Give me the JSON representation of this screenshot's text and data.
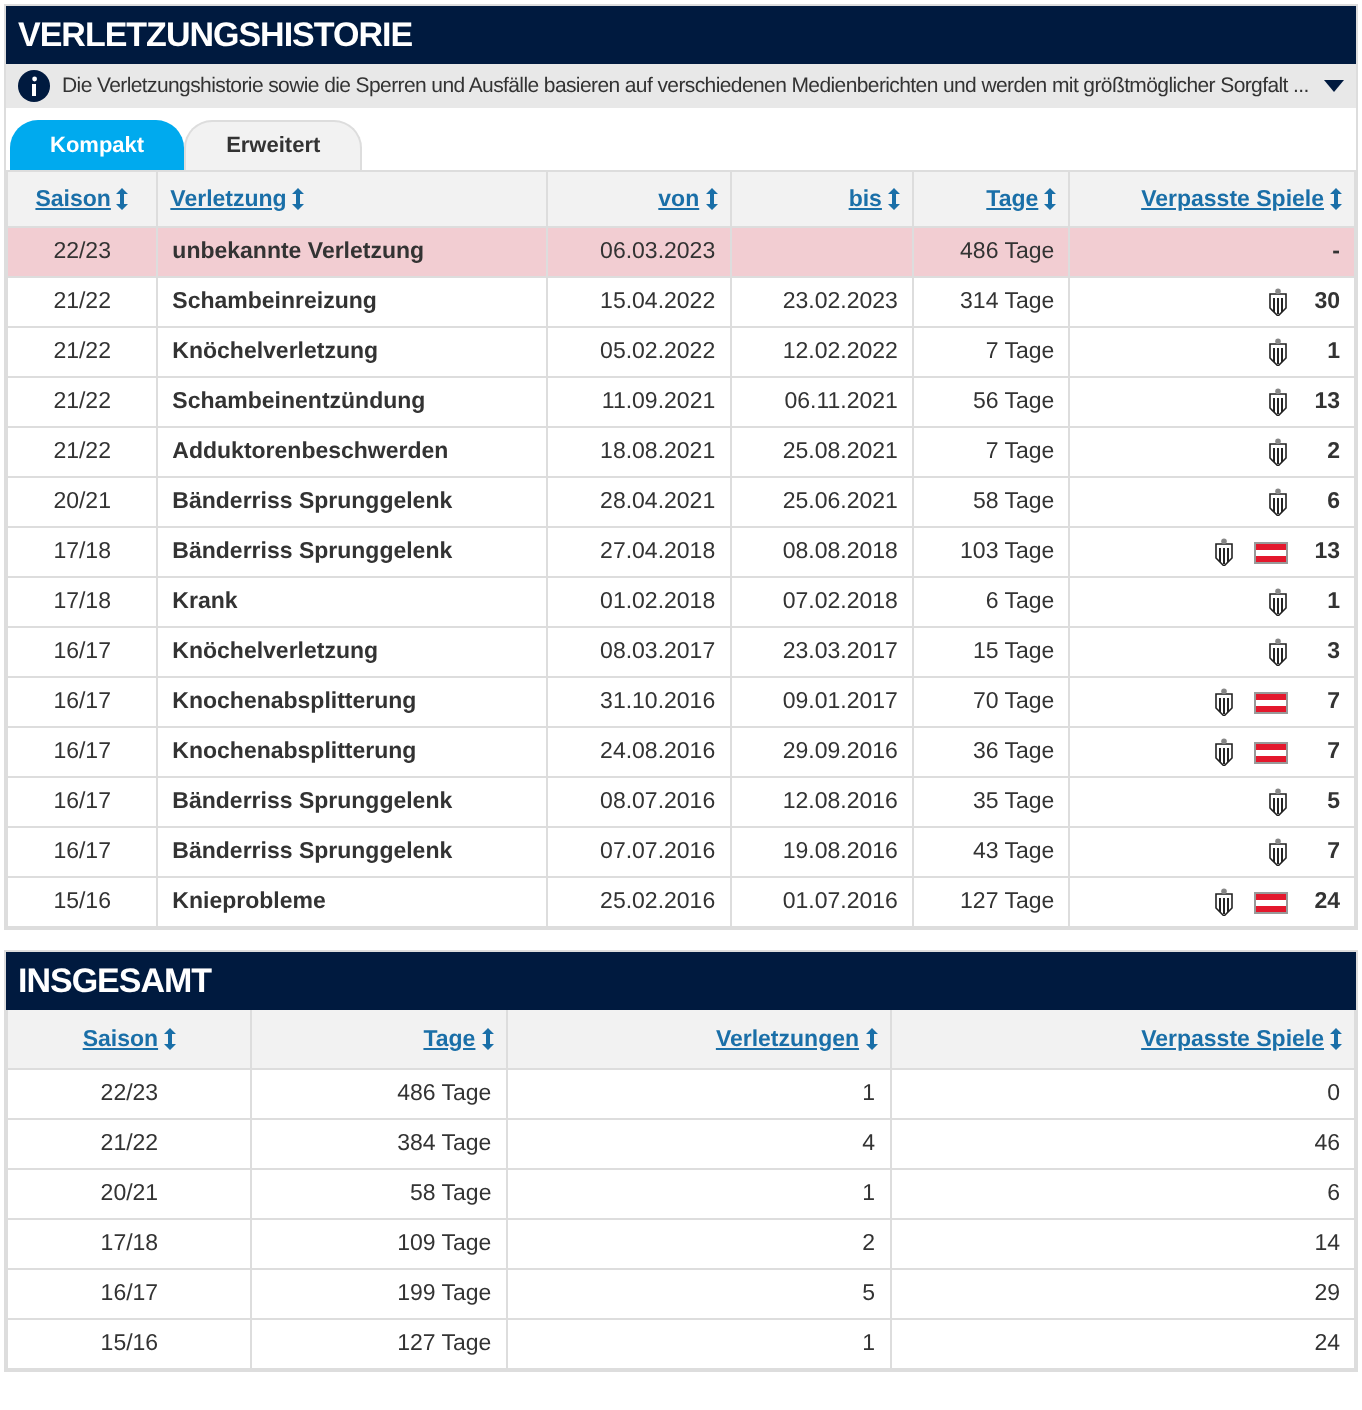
{
  "history": {
    "title": "VERLETZUNGSHISTORIE",
    "info": "Die Verletzungshistorie sowie die Sperren und Ausfälle basieren auf verschiedenen Medienberichten und werden mit größtmöglicher Sorgfalt ...",
    "tabs": [
      {
        "label": "Kompakt",
        "selected": true
      },
      {
        "label": "Erweitert",
        "selected": false
      }
    ],
    "columns": [
      "Saison",
      "Verletzung",
      "von",
      "bis",
      "Tage",
      "Verpasste Spiele"
    ],
    "rows": [
      {
        "season": "22/23",
        "injury": "unbekannte Verletzung",
        "from": "06.03.2023",
        "until": "",
        "days": "486 Tage",
        "icons": [],
        "games": "-",
        "current": true
      },
      {
        "season": "21/22",
        "injury": "Schambeinreizung",
        "from": "15.04.2022",
        "until": "23.02.2023",
        "days": "314 Tage",
        "icons": [
          {
            "kind": "club"
          }
        ],
        "games": "30",
        "current": false
      },
      {
        "season": "21/22",
        "injury": "Knöchelverletzung",
        "from": "05.02.2022",
        "until": "12.02.2022",
        "days": "7 Tage",
        "icons": [
          {
            "kind": "club"
          }
        ],
        "games": "1",
        "current": false
      },
      {
        "season": "21/22",
        "injury": "Schambeinentzündung",
        "from": "11.09.2021",
        "until": "06.11.2021",
        "days": "56 Tage",
        "icons": [
          {
            "kind": "club"
          }
        ],
        "games": "13",
        "current": false
      },
      {
        "season": "21/22",
        "injury": "Adduktorenbeschwerden",
        "from": "18.08.2021",
        "until": "25.08.2021",
        "days": "7 Tage",
        "icons": [
          {
            "kind": "club"
          }
        ],
        "games": "2",
        "current": false
      },
      {
        "season": "20/21",
        "injury": "Bänderriss Sprunggelenk",
        "from": "28.04.2021",
        "until": "25.06.2021",
        "days": "58 Tage",
        "icons": [
          {
            "kind": "club"
          }
        ],
        "games": "6",
        "current": false
      },
      {
        "season": "17/18",
        "injury": "Bänderriss Sprunggelenk",
        "from": "27.04.2018",
        "until": "08.08.2018",
        "days": "103 Tage",
        "icons": [
          {
            "kind": "club"
          },
          {
            "kind": "flag"
          }
        ],
        "games": "13",
        "current": false
      },
      {
        "season": "17/18",
        "injury": "Krank",
        "from": "01.02.2018",
        "until": "07.02.2018",
        "days": "6 Tage",
        "icons": [
          {
            "kind": "club"
          }
        ],
        "games": "1",
        "current": false
      },
      {
        "season": "16/17",
        "injury": "Knöchelverletzung",
        "from": "08.03.2017",
        "until": "23.03.2017",
        "days": "15 Tage",
        "icons": [
          {
            "kind": "club"
          }
        ],
        "games": "3",
        "current": false
      },
      {
        "season": "16/17",
        "injury": "Knochenabsplitterung",
        "from": "31.10.2016",
        "until": "09.01.2017",
        "days": "70 Tage",
        "icons": [
          {
            "kind": "club"
          },
          {
            "kind": "flag"
          }
        ],
        "games": "7",
        "current": false
      },
      {
        "season": "16/17",
        "injury": "Knochenabsplitterung",
        "from": "24.08.2016",
        "until": "29.09.2016",
        "days": "36 Tage",
        "icons": [
          {
            "kind": "club"
          },
          {
            "kind": "flag"
          }
        ],
        "games": "7",
        "current": false
      },
      {
        "season": "16/17",
        "injury": "Bänderriss Sprunggelenk",
        "from": "08.07.2016",
        "until": "12.08.2016",
        "days": "35 Tage",
        "icons": [
          {
            "kind": "club"
          }
        ],
        "games": "5",
        "current": false
      },
      {
        "season": "16/17",
        "injury": "Bänderriss Sprunggelenk",
        "from": "07.07.2016",
        "until": "19.08.2016",
        "days": "43 Tage",
        "icons": [
          {
            "kind": "club"
          }
        ],
        "games": "7",
        "current": false
      },
      {
        "season": "15/16",
        "injury": "Knieprobleme",
        "from": "25.02.2016",
        "until": "01.07.2016",
        "days": "127 Tage",
        "icons": [
          {
            "kind": "club"
          },
          {
            "kind": "flag"
          }
        ],
        "games": "24",
        "current": false
      }
    ]
  },
  "totals": {
    "title": "INSGESAMT",
    "columns": [
      "Saison",
      "Tage",
      "Verletzungen",
      "Verpasste Spiele"
    ],
    "rows": [
      [
        "22/23",
        "486 Tage",
        "1",
        "0"
      ],
      [
        "21/22",
        "384 Tage",
        "4",
        "46"
      ],
      [
        "20/21",
        "58 Tage",
        "1",
        "6"
      ],
      [
        "17/18",
        "109 Tage",
        "2",
        "14"
      ],
      [
        "16/17",
        "199 Tage",
        "5",
        "29"
      ],
      [
        "15/16",
        "127 Tage",
        "1",
        "24"
      ]
    ]
  }
}
